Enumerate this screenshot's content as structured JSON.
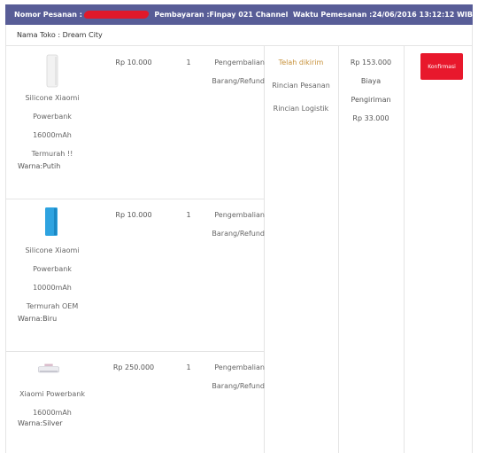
{
  "header": {
    "order_number_label": "Nomor Pesanan :",
    "payment_label": "Pembayaran :Finpay 021 Channel",
    "order_time_label": "Waktu Pemesanan :24/06/2016 13:12:12 WIB"
  },
  "store": {
    "label": "Nama Toko  : Dream City"
  },
  "items": [
    {
      "name_lines": [
        "Silicone Xiaomi",
        "Powerbank",
        "16000mAh",
        "Termurah !!"
      ],
      "color": "Warna:Putih",
      "price": "Rp 10.000",
      "qty": "1",
      "refund_lines": [
        "Pengembalian",
        "Barang/Refund"
      ],
      "thumb_color": "#f0f0f0"
    },
    {
      "name_lines": [
        "Silicone Xiaomi",
        "Powerbank",
        "10000mAh",
        "Termurah OEM"
      ],
      "color": "Warna:Biru",
      "price": "Rp 10.000",
      "qty": "1",
      "refund_lines": [
        "Pengembalian",
        "Barang/Refund"
      ],
      "thumb_color": "#2ea3e0"
    },
    {
      "name_lines": [
        "Xiaomi Powerbank",
        "16000mAh"
      ],
      "color": "Warna:Silver",
      "price": "Rp 250.000",
      "qty": "1",
      "refund_lines": [
        "Pengembalian",
        "Barang/Refund"
      ],
      "thumb_color": "#e8e8ec"
    }
  ],
  "status": {
    "sent": "Telah dikirim",
    "order_detail": "Rincian Pesanan",
    "logistic_detail": "Rincian Logistik"
  },
  "totals": {
    "total": "Rp 153.000",
    "shipping_label_1": "Biaya",
    "shipping_label_2": "Pengiriman",
    "shipping": "Rp 33.000"
  },
  "actions": {
    "confirm": "Konfirmasi"
  },
  "colors": {
    "header_bg": "#585d97",
    "confirm_bg": "#e8182c",
    "status_sent": "#c7913a"
  }
}
